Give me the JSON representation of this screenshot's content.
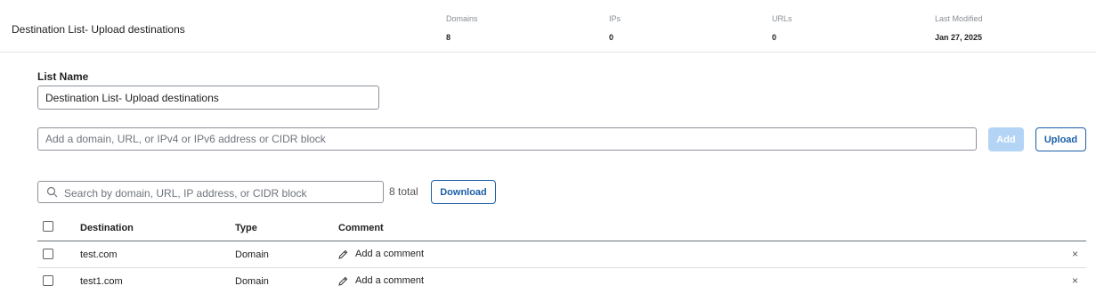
{
  "header": {
    "list_title": "Destination List- Upload destinations",
    "stats": [
      {
        "label": "Domains",
        "value": "8"
      },
      {
        "label": "IPs",
        "value": "0"
      },
      {
        "label": "URLs",
        "value": "0"
      },
      {
        "label": "Last Modified",
        "value": "Jan 27, 2025"
      }
    ]
  },
  "form": {
    "list_name_label": "List Name",
    "list_name_value": "Destination List- Upload destinations",
    "add_placeholder": "Add a domain, URL, or IPv4 or IPv6 address or CIDR block",
    "add_button": "Add",
    "upload_button": "Upload"
  },
  "search": {
    "placeholder": "Search by domain, URL, IP address, or CIDR block",
    "total": "8 total",
    "download_button": "Download"
  },
  "table": {
    "columns": [
      "Destination",
      "Type",
      "Comment"
    ],
    "rows": [
      {
        "destination": "test.com",
        "type": "Domain",
        "comment": "Add a comment"
      },
      {
        "destination": "test1.com",
        "type": "Domain",
        "comment": "Add a comment"
      }
    ]
  },
  "icons": {
    "search": "search-icon",
    "edit": "pencil-icon",
    "remove": "close-icon",
    "remove_glyph": "×"
  },
  "colors": {
    "accent": "#1b5fa8",
    "add_disabled": "#b3d4f5"
  }
}
